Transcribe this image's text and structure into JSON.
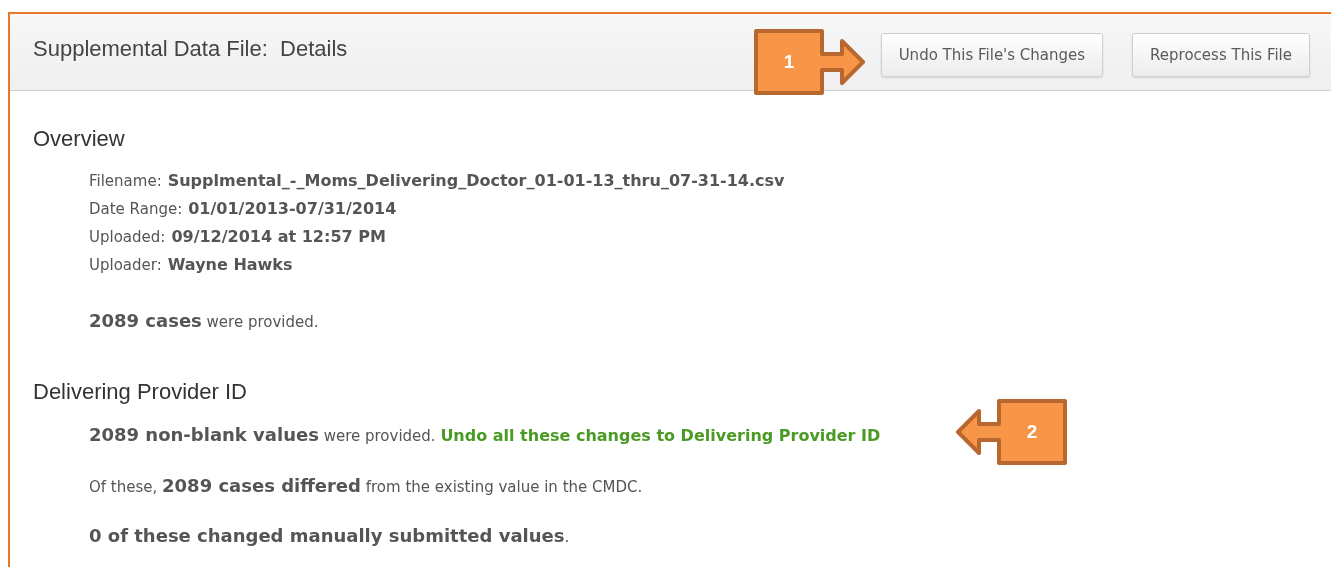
{
  "header": {
    "title": "Supplemental Data File:  Details",
    "buttons": [
      {
        "label": "Undo This File's Changes"
      },
      {
        "label": "Reprocess This File"
      }
    ]
  },
  "callouts": [
    {
      "number": "1",
      "kind": "right"
    },
    {
      "number": "2",
      "kind": "left"
    }
  ],
  "overview": {
    "heading": "Overview",
    "fields": [
      {
        "label": "Filename:",
        "value": "Supplmental_-_Moms_Delivering_Doctor_01-01-13_thru_07-31-14.csv"
      },
      {
        "label": "Date Range:",
        "value": "01/01/2013-07/31/2014"
      },
      {
        "label": "Uploaded:",
        "value": "09/12/2014 at 12:57 PM"
      },
      {
        "label": "Uploader:",
        "value": "Wayne Hawks"
      }
    ],
    "summary": "**2089 cases** were provided."
  },
  "field_section": {
    "heading": "Delivering Provider ID",
    "provided": "**2089 non-blank values** were provided.",
    "undo_link": "Undo all these changes to Delivering Provider ID",
    "differed": "Of these, **2089 cases differed** from the existing value in the CMDC.",
    "manual": "**0 of these changed manually submitted values**."
  }
}
